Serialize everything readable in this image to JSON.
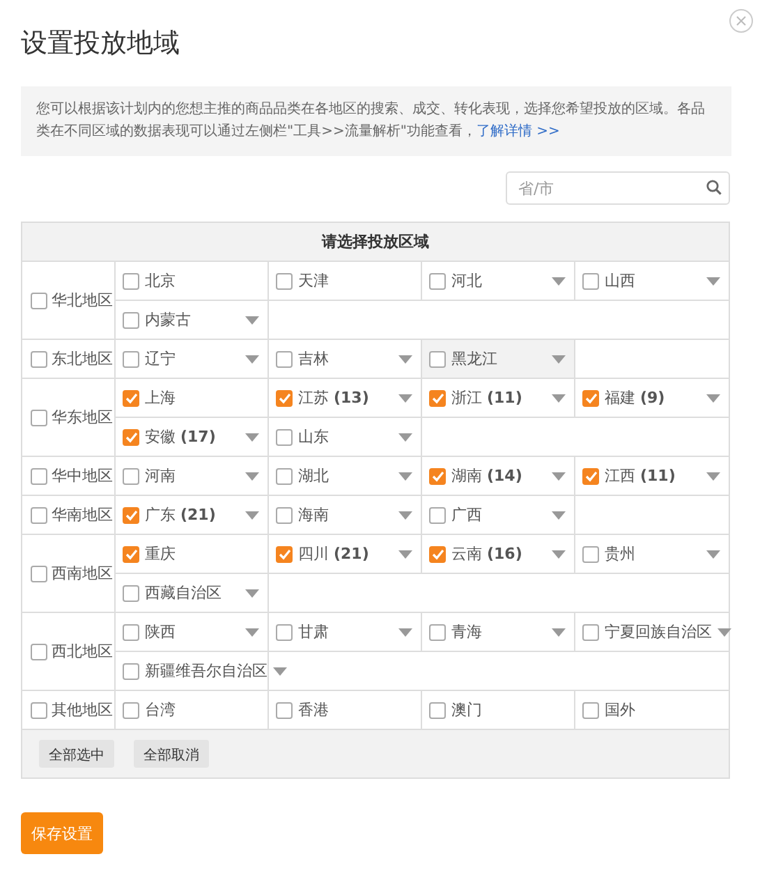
{
  "dialog": {
    "title": "设置投放地域",
    "info": "您可以根据该计划内的您想主推的商品品类在各地区的搜索、成交、转化表现，选择您希望投放的区域。各品类在不同区域的数据表现可以通过左侧栏\"工具>>流量解析\"功能查看，",
    "info_link": "了解详情 >>"
  },
  "search": {
    "placeholder": "省/市"
  },
  "table": {
    "header": "请选择投放区域",
    "regions": [
      {
        "name": "华北地区",
        "checked": false,
        "lines": [
          [
            {
              "label": "北京",
              "checked": false,
              "expandable": false,
              "hovered": false
            },
            {
              "label": "天津",
              "checked": false,
              "expandable": false,
              "hovered": false
            },
            {
              "label": "河北",
              "checked": false,
              "expandable": true,
              "hovered": false
            },
            {
              "label": "山西",
              "checked": false,
              "expandable": true,
              "hovered": false
            }
          ],
          [
            {
              "label": "内蒙古",
              "checked": false,
              "expandable": true,
              "hovered": false
            }
          ]
        ]
      },
      {
        "name": "东北地区",
        "checked": false,
        "lines": [
          [
            {
              "label": "辽宁",
              "checked": false,
              "expandable": true,
              "hovered": false
            },
            {
              "label": "吉林",
              "checked": false,
              "expandable": true,
              "hovered": false
            },
            {
              "label": "黑龙江",
              "checked": false,
              "expandable": true,
              "hovered": true
            }
          ]
        ]
      },
      {
        "name": "华东地区",
        "checked": false,
        "lines": [
          [
            {
              "label": "上海",
              "checked": true,
              "expandable": false,
              "hovered": false
            },
            {
              "label": "江苏 **(13)**",
              "checked": true,
              "expandable": true,
              "hovered": false
            },
            {
              "label": "浙江 **(11)**",
              "checked": true,
              "expandable": true,
              "hovered": false
            },
            {
              "label": "福建 **(9)**",
              "checked": true,
              "expandable": true,
              "hovered": false
            }
          ],
          [
            {
              "label": "安徽 **(17)**",
              "checked": true,
              "expandable": true,
              "hovered": false
            },
            {
              "label": "山东",
              "checked": false,
              "expandable": true,
              "hovered": false
            }
          ]
        ]
      },
      {
        "name": "华中地区",
        "checked": false,
        "lines": [
          [
            {
              "label": "河南",
              "checked": false,
              "expandable": true,
              "hovered": false
            },
            {
              "label": "湖北",
              "checked": false,
              "expandable": true,
              "hovered": false
            },
            {
              "label": "湖南 **(14)**",
              "checked": true,
              "expandable": true,
              "hovered": false
            },
            {
              "label": "江西 **(11)**",
              "checked": true,
              "expandable": true,
              "hovered": false
            }
          ]
        ]
      },
      {
        "name": "华南地区",
        "checked": false,
        "lines": [
          [
            {
              "label": "广东 **(21)**",
              "checked": true,
              "expandable": true,
              "hovered": false
            },
            {
              "label": "海南",
              "checked": false,
              "expandable": true,
              "hovered": false
            },
            {
              "label": "广西",
              "checked": false,
              "expandable": true,
              "hovered": false
            }
          ]
        ]
      },
      {
        "name": "西南地区",
        "checked": false,
        "lines": [
          [
            {
              "label": "重庆",
              "checked": true,
              "expandable": false,
              "hovered": false
            },
            {
              "label": "四川 **(21)**",
              "checked": true,
              "expandable": true,
              "hovered": false
            },
            {
              "label": "云南 **(16)**",
              "checked": true,
              "expandable": true,
              "hovered": false
            },
            {
              "label": "贵州",
              "checked": false,
              "expandable": true,
              "hovered": false
            }
          ],
          [
            {
              "label": "西藏自治区",
              "checked": false,
              "expandable": true,
              "hovered": false
            }
          ]
        ]
      },
      {
        "name": "西北地区",
        "checked": false,
        "lines": [
          [
            {
              "label": "陕西",
              "checked": false,
              "expandable": true,
              "hovered": false
            },
            {
              "label": "甘肃",
              "checked": false,
              "expandable": true,
              "hovered": false
            },
            {
              "label": "青海",
              "checked": false,
              "expandable": true,
              "hovered": false
            },
            {
              "label": "宁夏回族自治区",
              "checked": false,
              "expandable": true,
              "hovered": false
            }
          ],
          [
            {
              "label": "新疆维吾尔自治区",
              "checked": false,
              "expandable": true,
              "hovered": false
            }
          ]
        ]
      },
      {
        "name": "其他地区",
        "checked": false,
        "lines": [
          [
            {
              "label": "台湾",
              "checked": false,
              "expandable": false,
              "hovered": false
            },
            {
              "label": "香港",
              "checked": false,
              "expandable": false,
              "hovered": false
            },
            {
              "label": "澳门",
              "checked": false,
              "expandable": false,
              "hovered": false
            },
            {
              "label": "国外",
              "checked": false,
              "expandable": false,
              "hovered": false
            }
          ]
        ]
      }
    ],
    "footer_buttons": [
      "全部选中",
      "全部取消"
    ]
  },
  "save_button": "保存设置"
}
